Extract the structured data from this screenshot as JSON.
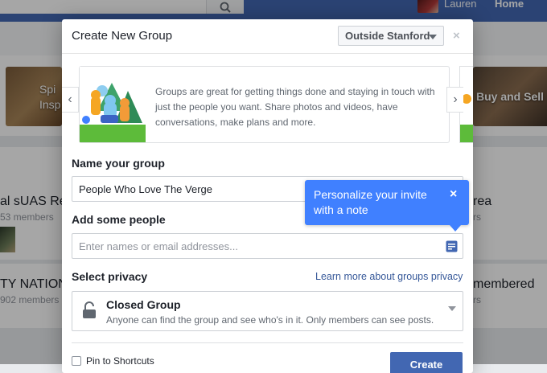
{
  "background": {
    "profile_name": "Lauren",
    "home_label": "Home",
    "card_left_text": "Spi\nInsp",
    "card_right_text": "Buy and Sell",
    "row1_left_title": "al sUAS Re",
    "row1_left_members": "53 members",
    "row1_right_title": "rea",
    "row1_right_members": "rs",
    "row2_left_title": "TY NATION",
    "row2_left_members": "902 members",
    "row2_right_title": "membered",
    "row2_right_members": "rs"
  },
  "dialog": {
    "title": "Create New Group",
    "network_select": "Outside Stanford",
    "close": "×",
    "promo_text": "Groups are great for getting things done and staying in touch with just the people you want. Share photos and videos, have conversations, make plans and more.",
    "arrow_left": "‹",
    "arrow_right": "›",
    "name_label": "Name your group",
    "name_value": "People Who Love The Verge",
    "add_people_label": "Add some people",
    "add_people_placeholder": "Enter names or email addresses...",
    "privacy_label": "Select privacy",
    "privacy_link": "Learn more about groups privacy",
    "privacy_option_title": "Closed Group",
    "privacy_option_desc": "Anyone can find the group and see who's in it. Only members can see posts.",
    "pin_label": "Pin to Shortcuts",
    "create_label": "Create"
  },
  "tooltip": {
    "text": "Personalize your invite with a note",
    "close": "×"
  },
  "icons": {
    "search": "search-icon",
    "lock": "lock-icon",
    "note": "note-icon"
  },
  "colors": {
    "brand_blue": "#4267b2",
    "tooltip_blue": "#4080ff",
    "link": "#365899"
  }
}
